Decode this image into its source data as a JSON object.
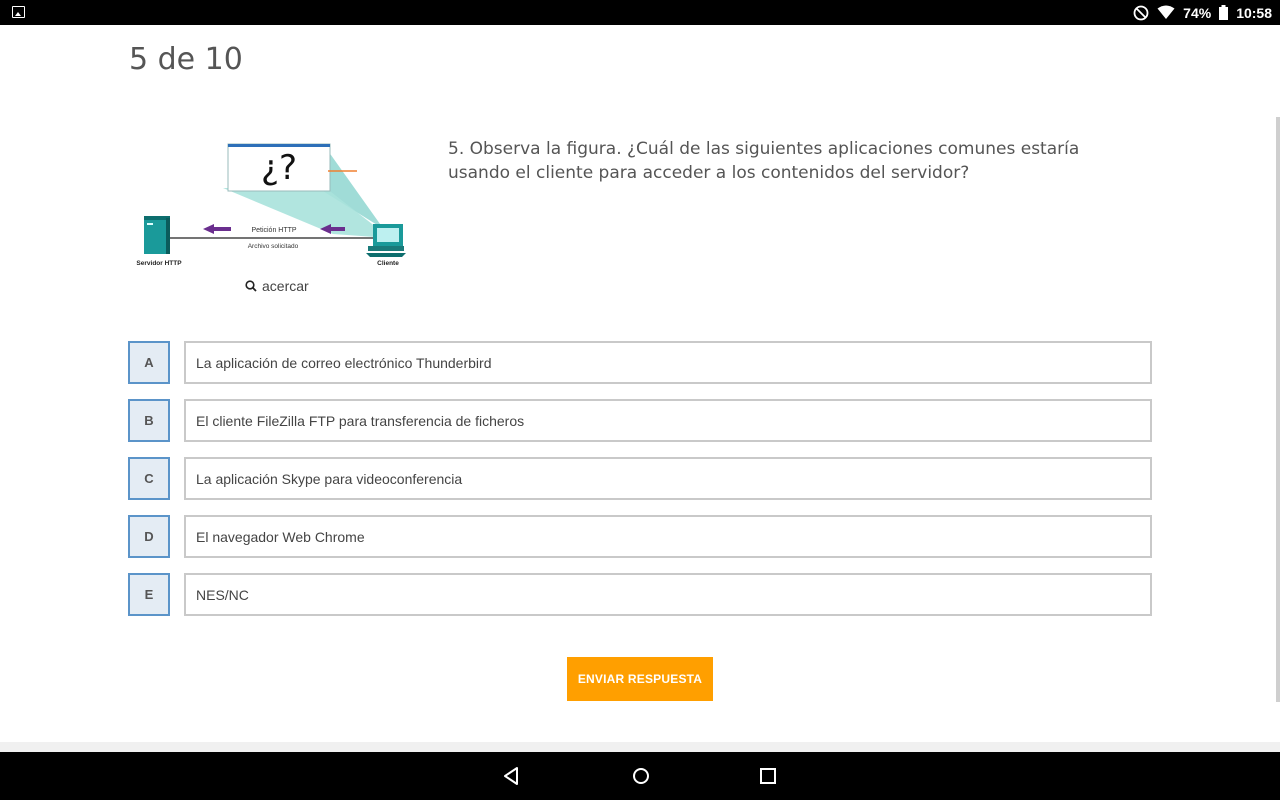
{
  "status_bar": {
    "battery_percent": "74%",
    "time": "10:58",
    "icons": [
      "gallery-icon",
      "do-not-disturb-icon",
      "wifi-icon",
      "battery-icon"
    ]
  },
  "quiz": {
    "counter": "5 de 10",
    "question": "5. Observa la figura. ¿Cuál de las siguientes aplicaciones comunes estaría usando el cliente para acceder a los contenidos del servidor?",
    "zoom_label": "acercar",
    "figure": {
      "callout": "¿?",
      "request_label": "Petición HTTP",
      "response_label": "Archivo solicitado",
      "server_label": "Servidor HTTP",
      "client_label": "Cliente"
    },
    "options": [
      {
        "letter": "A",
        "text": "La aplicación de correo electrónico Thunderbird"
      },
      {
        "letter": "B",
        "text": "El cliente FileZilla FTP para transferencia de ficheros"
      },
      {
        "letter": "C",
        "text": "La aplicación Skype para videoconferencia"
      },
      {
        "letter": "D",
        "text": "El navegador Web Chrome"
      },
      {
        "letter": "E",
        "text": "NES/NC"
      }
    ],
    "submit_label": "ENVIAR RESPUESTA"
  },
  "colors": {
    "accent": "#ff9f00",
    "option_border": "#5b94c9",
    "option_letter_bg": "#e4ecf4",
    "arrow": "#6a2e8e",
    "device": "#1a9a9a"
  },
  "nav_bar": {
    "icons": [
      "back-icon",
      "home-icon",
      "recents-icon"
    ]
  }
}
